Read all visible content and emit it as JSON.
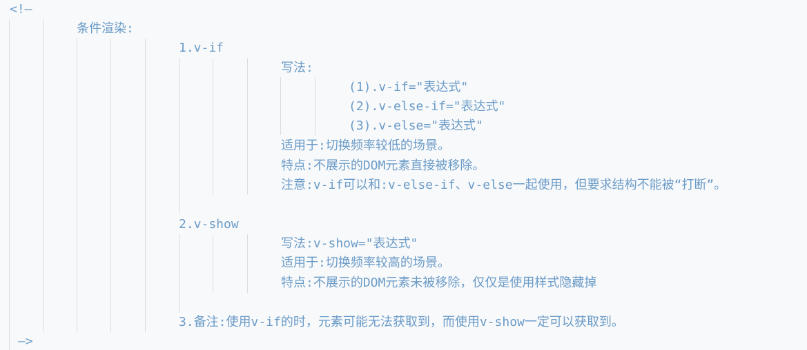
{
  "comment_open": "<!—",
  "comment_close": "—>",
  "heading": "条件渲染:",
  "sections": [
    {
      "title": "1.v-if",
      "syntax_label": "写法:",
      "syntax_lines": [
        "(1).v-if=\"表达式\"",
        "(2).v-else-if=\"表达式\"",
        "(3).v-else=\"表达式\""
      ],
      "usage": "适用于:切换频率较低的场景。",
      "feature": "特点:不展示的DOM元素直接被移除。",
      "note": "注意:v-if可以和:v-else-if、v-else一起使用，但要求结构不能被“打断”。"
    },
    {
      "title": "2.v-show",
      "syntax": "写法:v-show=\"表达式\"",
      "usage": "适用于:切换频率较高的场景。",
      "feature": "特点:不展示的DOM元素未被移除，仅仅是使用样式隐藏掉"
    }
  ],
  "remark": "3.备注:使用v-if的时，元素可能无法获取到，而使用v-show一定可以获取到。",
  "colors": {
    "background": "#f8f9fa",
    "comment_text": "#6a9bc8",
    "indent_guide": "#d9dde2"
  }
}
